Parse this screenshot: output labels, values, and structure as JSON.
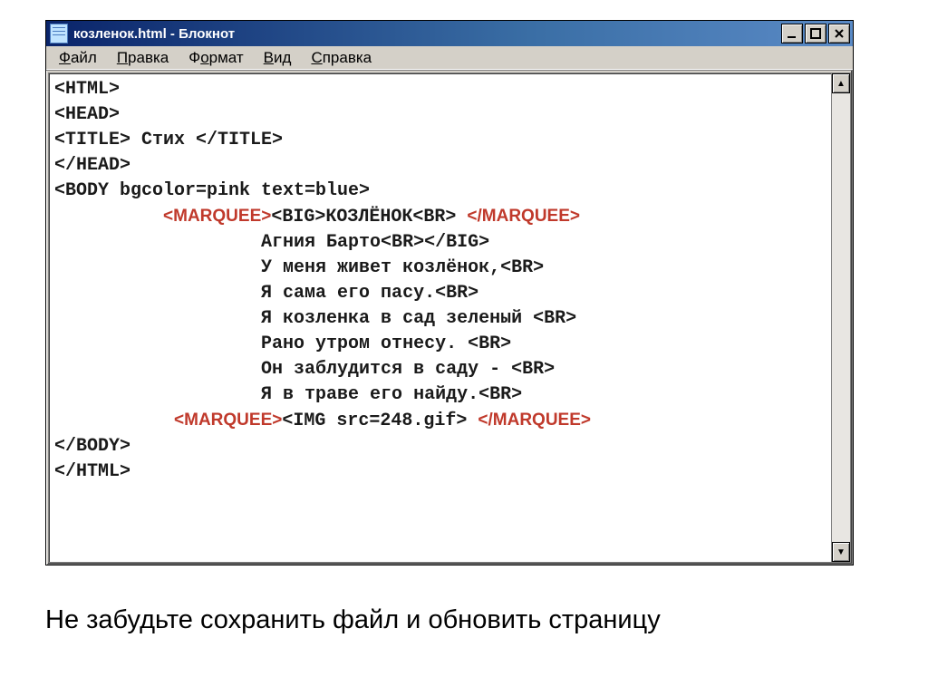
{
  "window": {
    "title": "козленок.html - Блокнот"
  },
  "menu": {
    "file": "Файл",
    "file_ul": "Ф",
    "edit": "Правка",
    "edit_ul": "П",
    "format": "Формат",
    "format_ul": "о",
    "view": "Вид",
    "view_ul": "В",
    "help": "Справка",
    "help_ul": "С"
  },
  "marquee": {
    "open": "<MARQUEE>",
    "close": "</MARQUEE>"
  },
  "code": {
    "l01": "<HTML>",
    "l02": "<HEAD>",
    "l03": "<TITLE> Стих </TITLE>",
    "l04": "</HEAD>",
    "l05": "<BODY bgcolor=pink text=blue>",
    "l06_pad": "          ",
    "l06_right": "<BIG>КОЗЛЁНОК<BR>",
    "l07": "                   Агния Барто<BR></BIG>",
    "l08": "                   У меня живет козлёнок,<BR>",
    "l09": "                   Я сама его пасу.<BR>",
    "l10": "                   Я козленка в сад зеленый <BR>",
    "l11": "                   Рано утром отнесу. <BR>",
    "l12": "                   Он заблудится в саду - <BR>",
    "l13": "                   Я в траве его найду.<BR>",
    "l14_pad": "           ",
    "l14_right": "<IMG src=248.gif>",
    "l15": "</BODY>",
    "l16": "</HTML>"
  },
  "footer": "Не забудьте сохранить файл и обновить страницу"
}
